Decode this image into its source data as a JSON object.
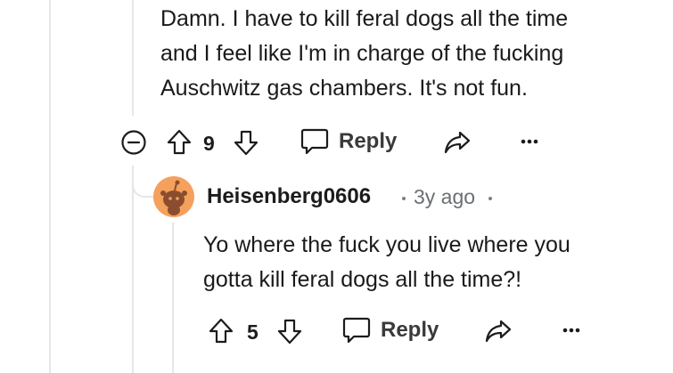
{
  "parent_comment": {
    "body_lines": [
      "Damn. I have to kill feral dogs all the time",
      "and I feel like I'm in charge of the fucking",
      "Auschwitz gas chambers. It's not fun."
    ],
    "vote_count": "9",
    "reply_label": "Reply",
    "icons": [
      "collapse-icon",
      "upvote-icon",
      "downvote-icon",
      "reply-bubble-icon",
      "share-icon",
      "more-icon"
    ]
  },
  "reply_comment": {
    "author": "Heisenberg0606",
    "age": "3y ago",
    "body_lines": [
      "Yo where the fuck you live where you",
      "gotta kill feral dogs all the time?!"
    ],
    "vote_count": "5",
    "reply_label": "Reply",
    "avatar_color": "#f5a05c"
  }
}
